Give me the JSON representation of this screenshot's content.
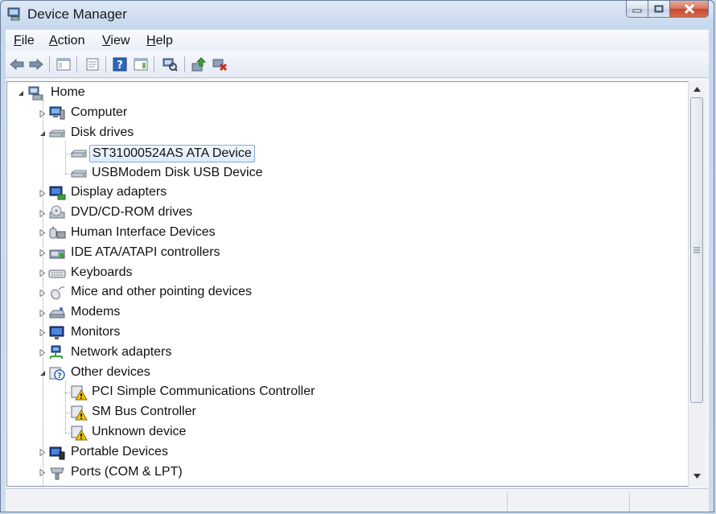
{
  "window": {
    "title": "Device Manager"
  },
  "menu": [
    {
      "label": "File",
      "mnemonic": "F",
      "rest": "ile"
    },
    {
      "label": "Action",
      "mnemonic": "A",
      "rest": "ction"
    },
    {
      "label": "View",
      "mnemonic": "V",
      "rest": "iew"
    },
    {
      "label": "Help",
      "mnemonic": "H",
      "rest": "elp"
    }
  ],
  "toolbar": [
    "back-arrow-icon",
    "forward-arrow-icon",
    "show-hide-console-tree-icon",
    "properties-icon",
    "help-icon",
    "show-action-pane-icon",
    "scan-hardware-icon",
    "update-driver-icon",
    "uninstall-device-icon"
  ],
  "tree": {
    "root": "Home",
    "items": [
      {
        "label": "Computer",
        "icon": "computer-icon",
        "expanded": false
      },
      {
        "label": "Disk drives",
        "icon": "disk-drive-icon",
        "expanded": true,
        "children": [
          {
            "label": "ST31000524AS ATA Device",
            "selected": true
          },
          {
            "label": "USBModem Disk USB Device"
          }
        ]
      },
      {
        "label": "Display adapters",
        "icon": "display-adapter-icon",
        "expanded": false
      },
      {
        "label": "DVD/CD-ROM drives",
        "icon": "dvd-drive-icon",
        "expanded": false
      },
      {
        "label": "Human Interface Devices",
        "icon": "hid-icon",
        "expanded": false
      },
      {
        "label": "IDE ATA/ATAPI controllers",
        "icon": "ide-controller-icon",
        "expanded": false
      },
      {
        "label": "Keyboards",
        "icon": "keyboard-icon",
        "expanded": false
      },
      {
        "label": "Mice and other pointing devices",
        "icon": "mouse-icon",
        "expanded": false
      },
      {
        "label": "Modems",
        "icon": "modem-icon",
        "expanded": false
      },
      {
        "label": "Monitors",
        "icon": "monitor-icon",
        "expanded": false
      },
      {
        "label": "Network adapters",
        "icon": "network-adapter-icon",
        "expanded": false
      },
      {
        "label": "Other devices",
        "icon": "unknown-device-icon",
        "expanded": true,
        "children": [
          {
            "label": "PCI Simple Communications Controller"
          },
          {
            "label": "SM Bus Controller"
          },
          {
            "label": "Unknown device"
          }
        ]
      },
      {
        "label": "Portable Devices",
        "icon": "portable-device-icon",
        "expanded": false
      },
      {
        "label": "Ports (COM & LPT)",
        "icon": "port-icon",
        "expanded": false
      }
    ]
  },
  "colors": {
    "accent": "#2f67b8",
    "warning": "#f2c300",
    "selection_border": "#84acdd"
  }
}
